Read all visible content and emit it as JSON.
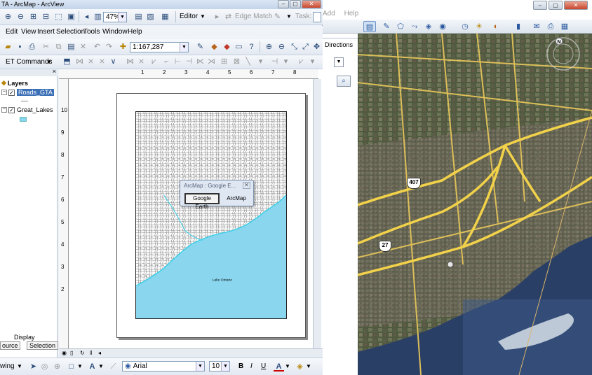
{
  "arcmap": {
    "title": "TA - ArcMap - ArcView",
    "zoom_combo": "47%",
    "editor_label": "Editor",
    "edge_match_label": "Edge Match",
    "task_label": "Task:",
    "menu": [
      "Edit",
      "View",
      "Insert",
      "Selection",
      "Tools",
      "Window",
      "Help"
    ],
    "scale": "1:167,287",
    "et_commands": "ET Commands",
    "toc": {
      "title": "Layers",
      "layers": [
        {
          "name": "Roads_GTA",
          "checked": true,
          "selected": true
        },
        {
          "name": "Great_Lakes",
          "checked": true,
          "selected": false
        }
      ],
      "tab_display": "Display",
      "tab_source": "ource",
      "tab_selection": "Selection"
    },
    "ruler_h": [
      "1",
      "2",
      "3",
      "4",
      "5",
      "6",
      "7",
      "8"
    ],
    "ruler_v": [
      "10",
      "9",
      "8",
      "7",
      "6",
      "5",
      "4",
      "3",
      "2"
    ],
    "map_label": "Lake Ontario",
    "draw_label": "wing",
    "font_name": "Arial",
    "font_size": "10",
    "bold": "B",
    "italic": "I",
    "underline": "U",
    "colors": {
      "water": "#8ad6ee",
      "selection": "#3b6fb6",
      "glow": "#3ad0e8"
    }
  },
  "dialog": {
    "title": "ArcMap : Google E...",
    "button_google_earth": "Google Earth",
    "button_arcmap": "ArcMap"
  },
  "google_earth": {
    "menu_add": "Add",
    "menu_help": "Help",
    "tab_directions": "Directions",
    "compass_n": "N",
    "shields": [
      "407",
      "27"
    ]
  }
}
